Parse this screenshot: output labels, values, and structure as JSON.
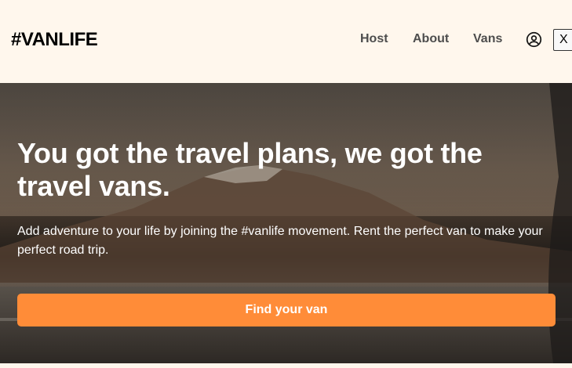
{
  "header": {
    "logo": "#VANLIFE",
    "nav": [
      {
        "label": "Host"
      },
      {
        "label": "About"
      },
      {
        "label": "Vans"
      }
    ],
    "profile_icon": "user-circle-icon",
    "logout_label": "X"
  },
  "hero": {
    "title": "You got the travel plans, we got the travel vans.",
    "text": "Add adventure to your life by joining the #vanlife movement. Rent the perfect van to make your perfect road trip.",
    "cta_label": "Find your van"
  },
  "colors": {
    "background": "#FFF7ED",
    "accent": "#FF8C38",
    "nav_text": "#4D4D4D"
  }
}
